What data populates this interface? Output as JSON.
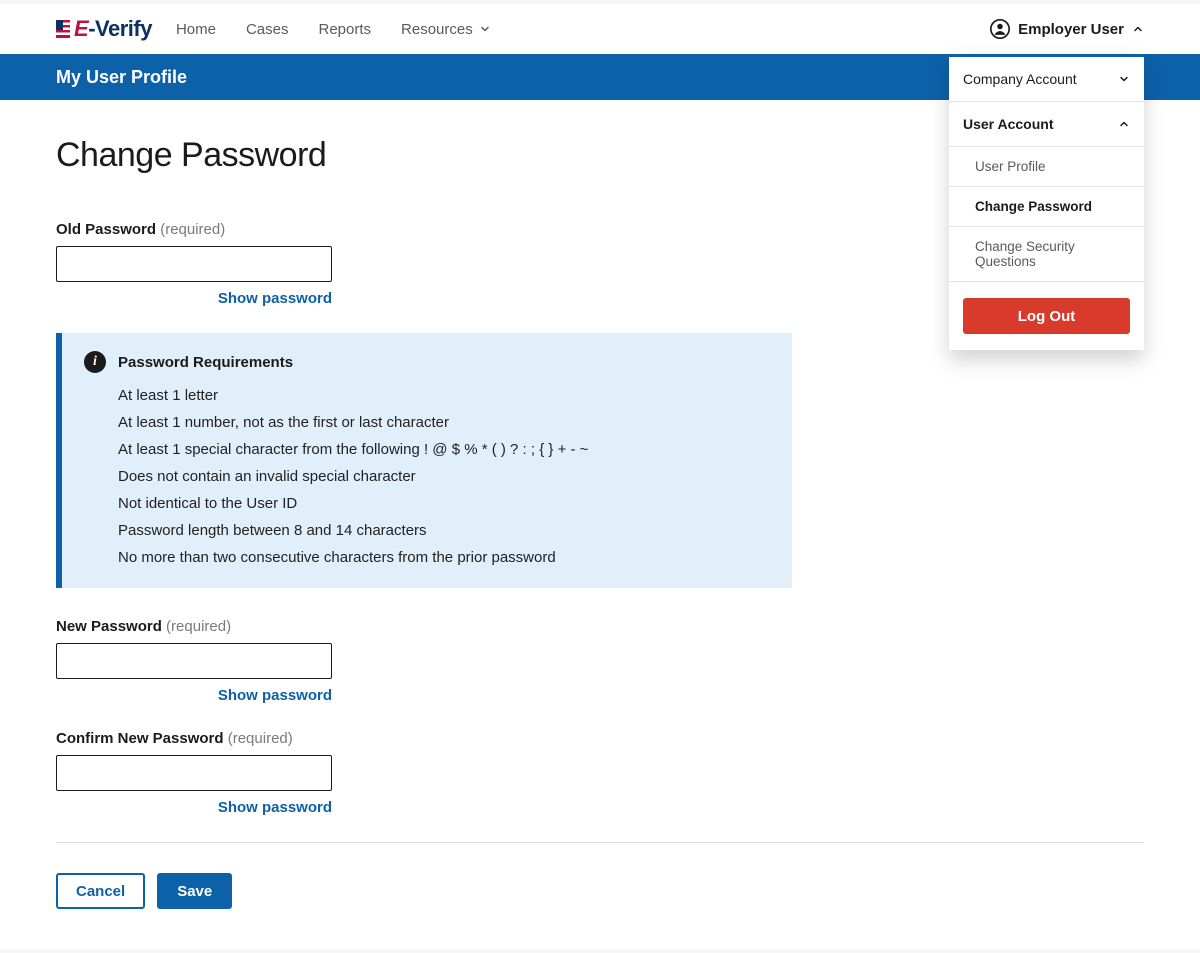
{
  "brand": {
    "e": "E",
    "dash": "-",
    "verify": "Verify"
  },
  "nav": {
    "home": "Home",
    "cases": "Cases",
    "reports": "Reports",
    "resources": "Resources"
  },
  "user_menu": {
    "trigger": "Employer User",
    "company_account": "Company Account",
    "user_account": "User Account",
    "user_profile": "User Profile",
    "change_password": "Change Password",
    "change_security_questions": "Change Security Questions",
    "log_out": "Log Out"
  },
  "banner_title": "My User Profile",
  "page_title": "Change Password",
  "form": {
    "old_password_label": "Old Password",
    "new_password_label": "New Password",
    "confirm_password_label": "Confirm New Password",
    "required_text": "(required)",
    "show_password": "Show password"
  },
  "requirements": {
    "heading": "Password Requirements",
    "items": [
      "At least 1 letter",
      "At least 1 number, not as the first or last character",
      "At least 1 special character from the following ! @ $ % * ( ) ? : ; { } + - ~",
      "Does not contain an invalid special character",
      "Not identical to the User ID",
      "Password length between 8 and 14 characters",
      "No more than two consecutive characters from the prior password"
    ]
  },
  "buttons": {
    "cancel": "Cancel",
    "save": "Save"
  }
}
